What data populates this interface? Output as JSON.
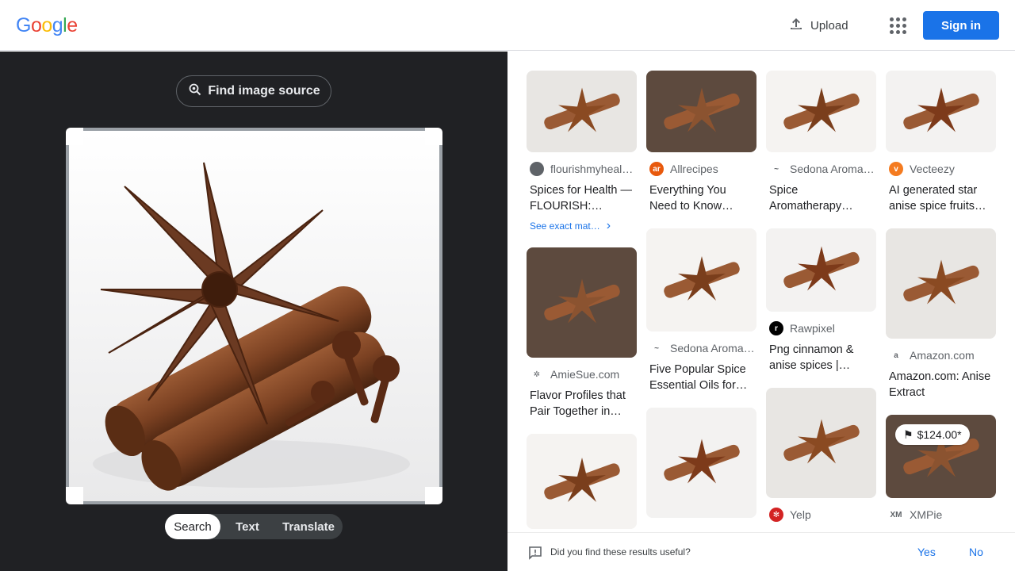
{
  "header": {
    "logo_letters": [
      {
        "ch": "G",
        "color": "#4285F4"
      },
      {
        "ch": "o",
        "color": "#EA4335"
      },
      {
        "ch": "o",
        "color": "#FBBC05"
      },
      {
        "ch": "g",
        "color": "#4285F4"
      },
      {
        "ch": "l",
        "color": "#34A853"
      },
      {
        "ch": "e",
        "color": "#EA4335"
      }
    ],
    "upload_label": "Upload",
    "signin_label": "Sign in"
  },
  "left_panel": {
    "find_source_label": "Find image source",
    "mode_tabs": [
      {
        "label": "Search",
        "active": true
      },
      {
        "label": "Text",
        "active": false
      },
      {
        "label": "Translate",
        "active": false
      }
    ]
  },
  "results": {
    "columns": [
      [
        {
          "source": "flourishmyheal…",
          "title": "Spices for Health — FLOURISH:…",
          "favicon_color": "#5f6368",
          "favicon_text": "",
          "exact_match": "See exact mat…",
          "thumb_h": 103
        },
        {
          "source": "AmieSue.com",
          "title": "Flavor Profiles that Pair Together in…",
          "favicon_color": "#ffffff",
          "favicon_text": "✲",
          "thumb_h": 139
        },
        {
          "source": "",
          "title": "",
          "favicon_color": "",
          "favicon_text": "",
          "thumb_h": 120
        }
      ],
      [
        {
          "source": "Allrecipes",
          "title": "Everything You Need to Know…",
          "favicon_color": "#e8590c",
          "favicon_text": "ar",
          "thumb_h": 103
        },
        {
          "source": "Sedona Aroma…",
          "title": "Five Popular Spice Essential Oils for…",
          "favicon_color": "#ffffff",
          "favicon_text": "~",
          "thumb_h": 130
        },
        {
          "source": "",
          "title": "",
          "favicon_color": "",
          "favicon_text": "",
          "thumb_h": 139
        }
      ],
      [
        {
          "source": "Sedona Aroma…",
          "title": "Spice Aromatherapy…",
          "favicon_color": "#ffffff",
          "favicon_text": "~",
          "thumb_h": 103
        },
        {
          "source": "Rawpixel",
          "title": "Png cinnamon & anise spices |…",
          "favicon_color": "#000000",
          "favicon_text": "r",
          "thumb_h": 105
        },
        {
          "source": "Yelp",
          "title": "",
          "favicon_color": "#d32323",
          "favicon_text": "✻",
          "thumb_h": 139
        }
      ],
      [
        {
          "source": "Vecteezy",
          "title": "AI generated star anise spice fruits…",
          "favicon_color": "#f47b20",
          "favicon_text": "v",
          "thumb_h": 103
        },
        {
          "source": "Amazon.com",
          "title": "Amazon.com: Anise Extract",
          "favicon_color": "#ffffff",
          "favicon_text": "a",
          "thumb_h": 139
        },
        {
          "source": "XMPie",
          "title": "",
          "favicon_color": "#ffffff",
          "favicon_text": "XM",
          "thumb_h": 105,
          "price": "$124.00*"
        }
      ]
    ]
  },
  "feedback": {
    "question": "Did you find these results useful?",
    "yes": "Yes",
    "no": "No"
  }
}
